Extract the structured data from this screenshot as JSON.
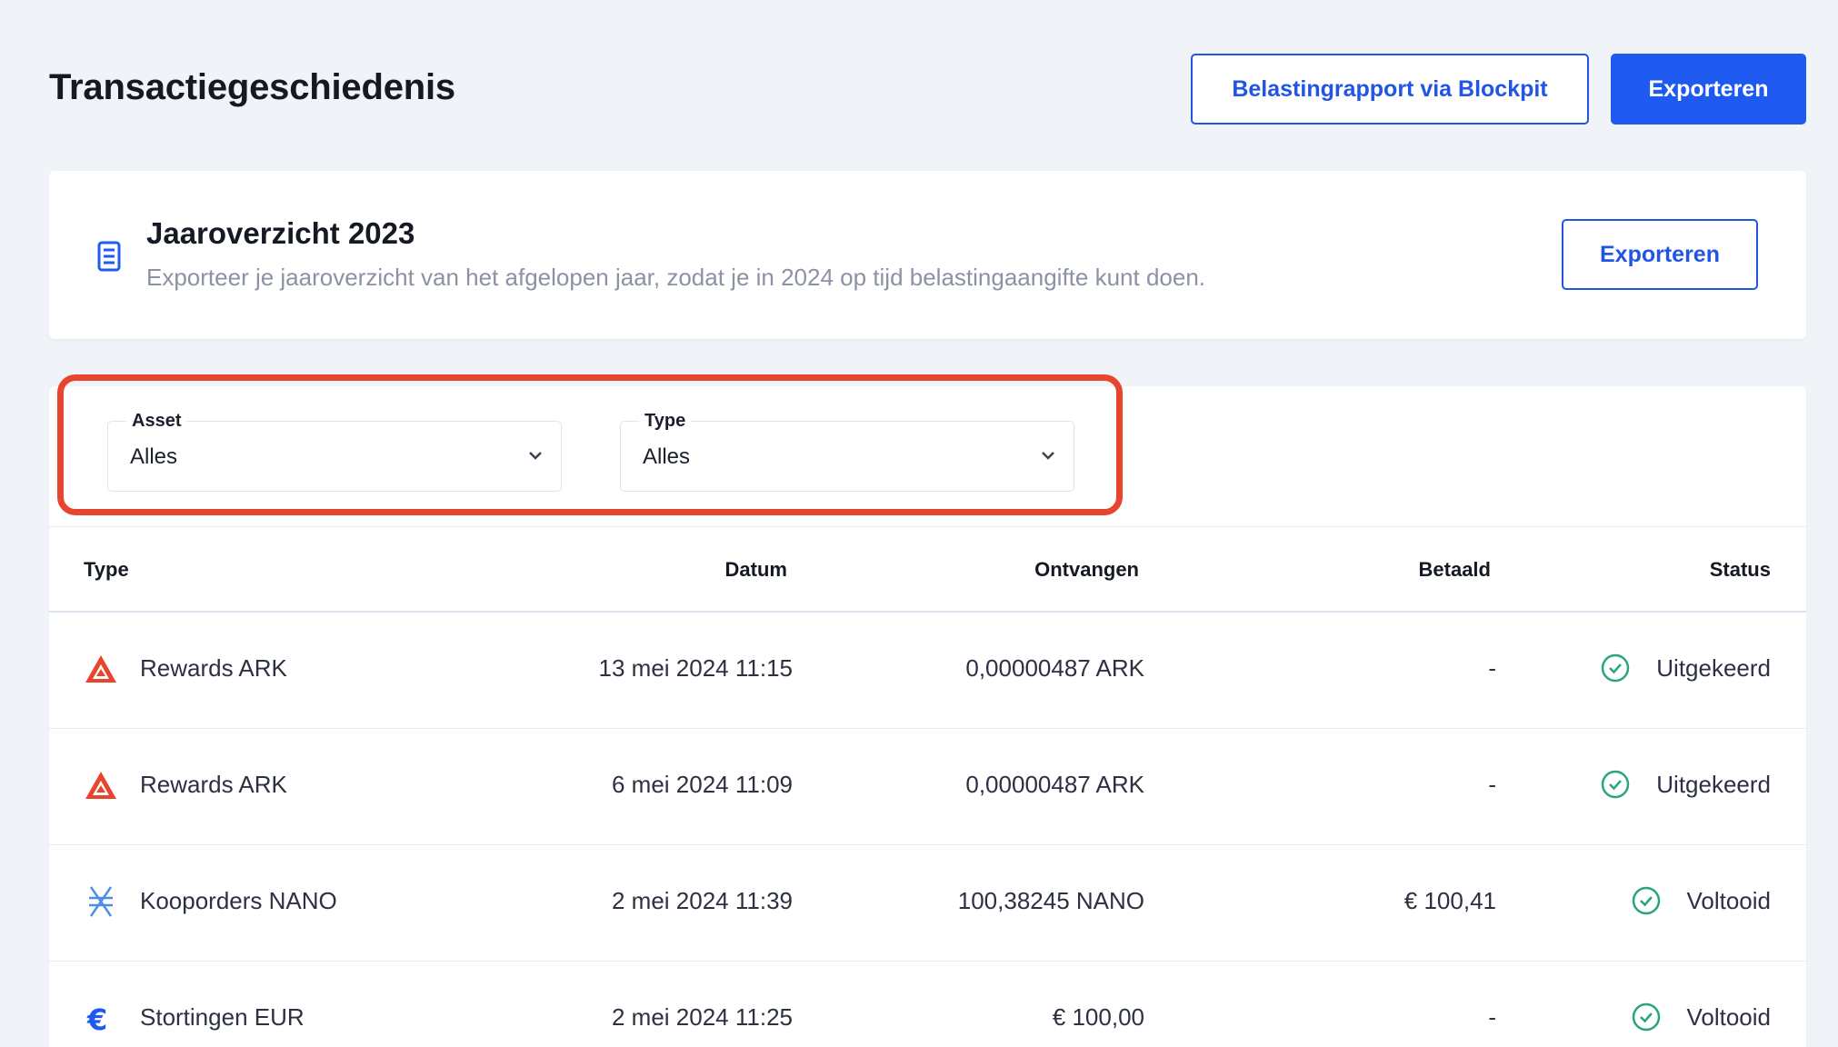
{
  "header": {
    "title": "Transactiegeschiedenis",
    "blockpit_label": "Belastingrapport via Blockpit",
    "export_label": "Exporteren"
  },
  "annual": {
    "title": "Jaaroverzicht 2023",
    "description": "Exporteer je jaaroverzicht van het afgelopen jaar, zodat je in 2024 op tijd belastingaangifte kunt doen.",
    "export_label": "Exporteren"
  },
  "filters": {
    "asset": {
      "label": "Asset",
      "value": "Alles"
    },
    "type": {
      "label": "Type",
      "value": "Alles"
    }
  },
  "table": {
    "headers": [
      "Type",
      "Datum",
      "Ontvangen",
      "Betaald",
      "Status"
    ],
    "rows": [
      {
        "icon": "ark-icon",
        "type": "Rewards ARK",
        "date": "13 mei 2024 11:15",
        "received": "0,00000487 ARK",
        "paid": "-",
        "status": "Uitgekeerd"
      },
      {
        "icon": "ark-icon",
        "type": "Rewards ARK",
        "date": "6 mei 2024 11:09",
        "received": "0,00000487 ARK",
        "paid": "-",
        "status": "Uitgekeerd"
      },
      {
        "icon": "nano-icon",
        "type": "Kooporders NANO",
        "date": "2 mei 2024 11:39",
        "received": "100,38245 NANO",
        "paid": "€ 100,41",
        "status": "Voltooid"
      },
      {
        "icon": "euro-icon",
        "type": "Stortingen EUR",
        "date": "2 mei 2024 11:25",
        "received": "€ 100,00",
        "paid": "-",
        "status": "Voltooid"
      }
    ]
  },
  "colors": {
    "primary": "#1f5af0",
    "highlight": "#e8452f",
    "success": "#2aa57a",
    "ark": "#e8452f",
    "nano": "#4a90e2",
    "euro": "#1f5af0"
  }
}
